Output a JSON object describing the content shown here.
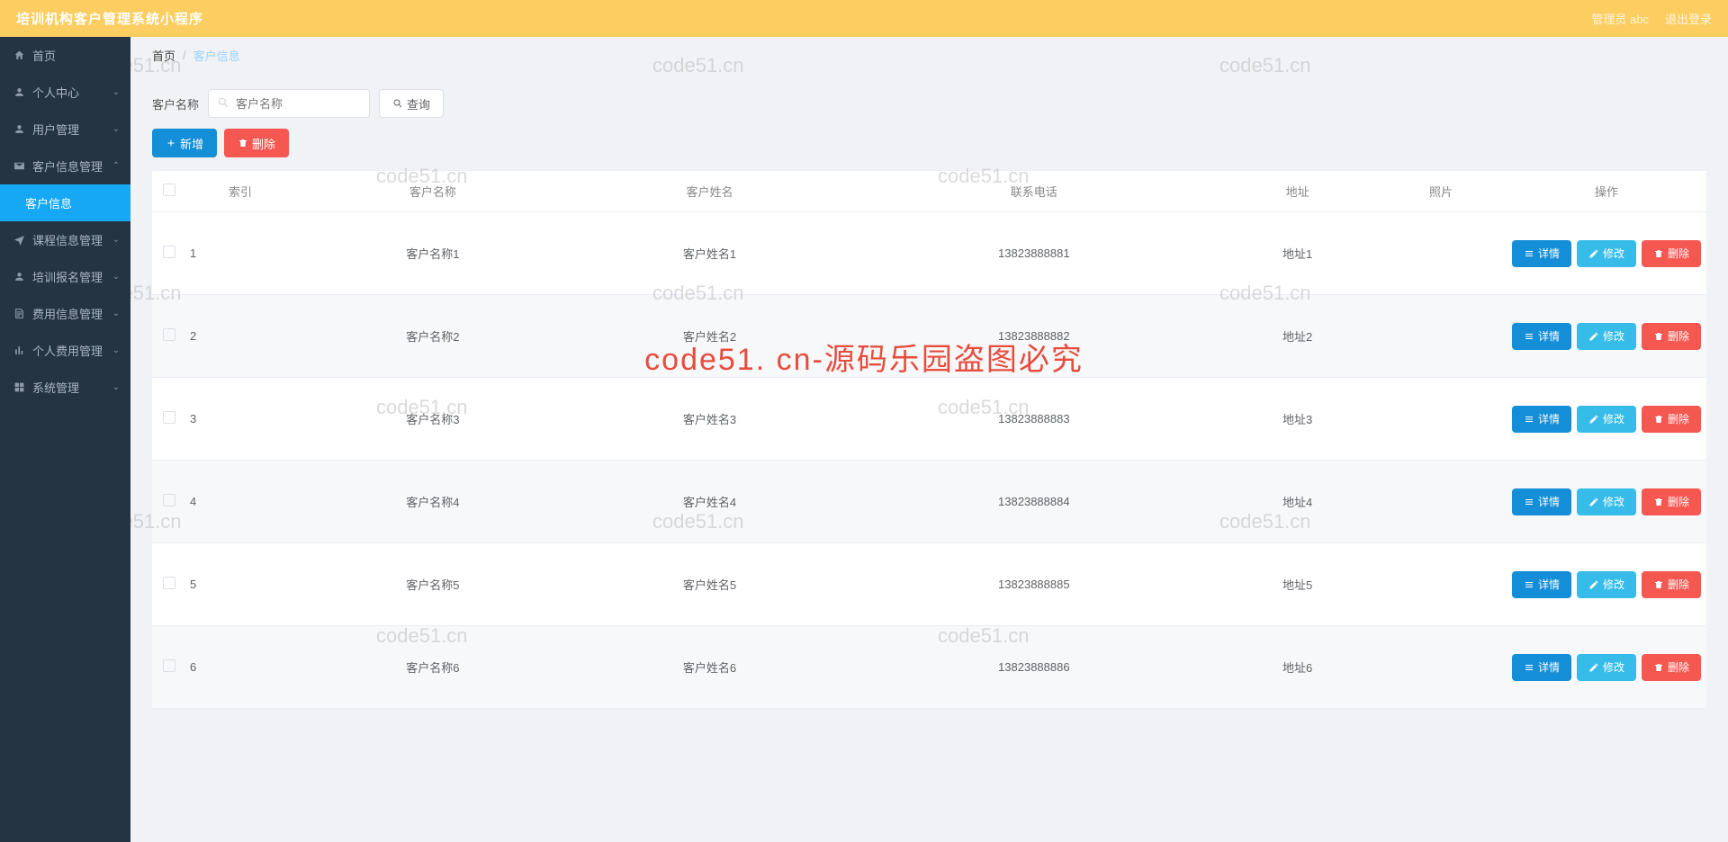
{
  "header": {
    "title": "培训机构客户管理系统小程序",
    "admin": "管理员 abc",
    "logout": "退出登录"
  },
  "sidebar": {
    "home": "首页",
    "items": [
      {
        "label": "个人中心",
        "icon": "user"
      },
      {
        "label": "用户管理",
        "icon": "user"
      },
      {
        "label": "客户信息管理",
        "icon": "mail",
        "expanded": true
      },
      {
        "label": "课程信息管理",
        "icon": "plane"
      },
      {
        "label": "培训报名管理",
        "icon": "user"
      },
      {
        "label": "费用信息管理",
        "icon": "doc"
      },
      {
        "label": "个人费用管理",
        "icon": "bar"
      },
      {
        "label": "系统管理",
        "icon": "grid"
      }
    ],
    "sub_active": "客户信息"
  },
  "breadcrumb": {
    "root": "首页",
    "current": "客户信息"
  },
  "search": {
    "label": "客户名称",
    "placeholder": "客户名称",
    "query_btn": "查询"
  },
  "toolbar": {
    "add": "新增",
    "del": "删除"
  },
  "table": {
    "headers": {
      "index": "索引",
      "name": "客户名称",
      "person": "客户姓名",
      "phone": "联系电话",
      "addr": "地址",
      "photo": "照片",
      "ops": "操作"
    },
    "ops": {
      "detail": "详情",
      "edit": "修改",
      "del": "删除"
    },
    "rows": [
      {
        "idx": "1",
        "name": "客户名称1",
        "person": "客户姓名1",
        "phone": "13823888881",
        "addr": "地址1"
      },
      {
        "idx": "2",
        "name": "客户名称2",
        "person": "客户姓名2",
        "phone": "13823888882",
        "addr": "地址2"
      },
      {
        "idx": "3",
        "name": "客户名称3",
        "person": "客户姓名3",
        "phone": "13823888883",
        "addr": "地址3"
      },
      {
        "idx": "4",
        "name": "客户名称4",
        "person": "客户姓名4",
        "phone": "13823888884",
        "addr": "地址4"
      },
      {
        "idx": "5",
        "name": "客户名称5",
        "person": "客户姓名5",
        "phone": "13823888885",
        "addr": "地址5"
      },
      {
        "idx": "6",
        "name": "客户名称6",
        "person": "客户姓名6",
        "phone": "13823888886",
        "addr": "地址6"
      }
    ]
  },
  "watermark": "code51.cn",
  "big_watermark": "code51. cn-源码乐园盗图必究"
}
